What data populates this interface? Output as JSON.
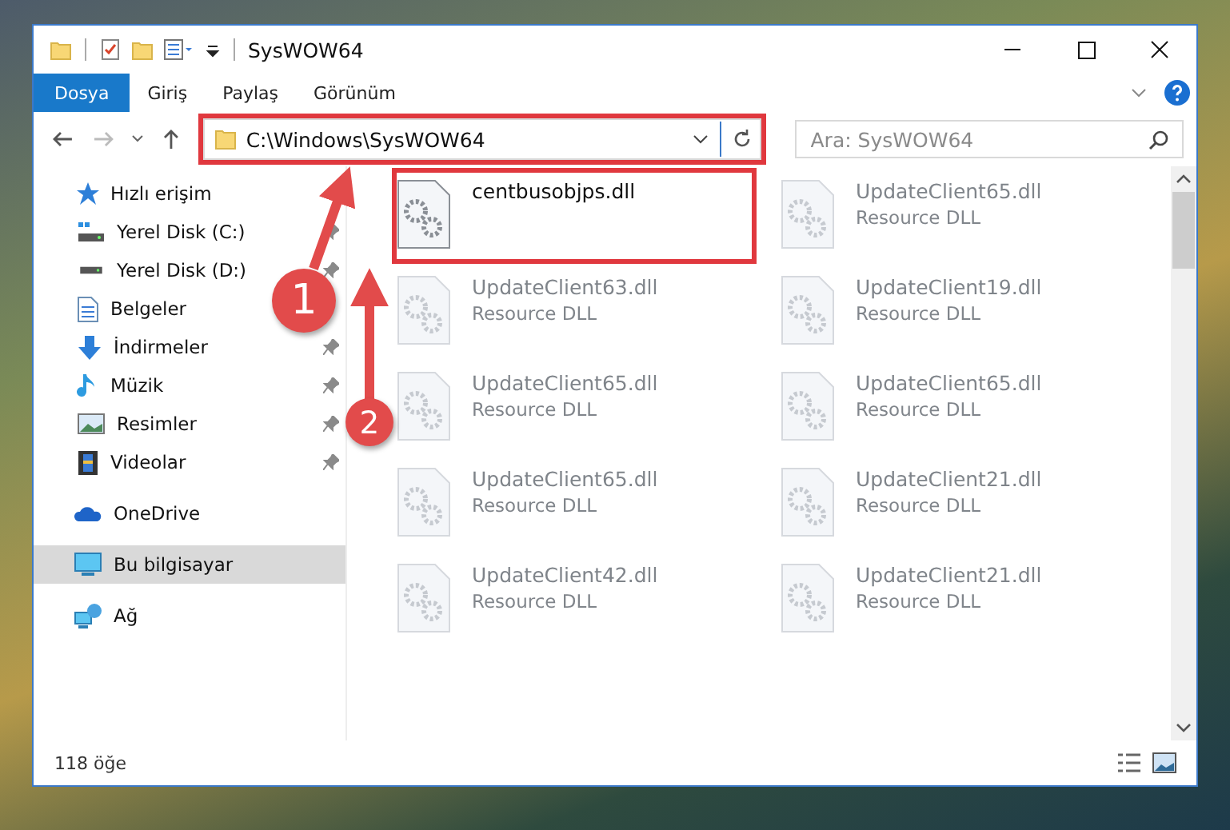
{
  "window": {
    "title": "SysWOW64"
  },
  "ribbon_tabs": [
    {
      "label": "Dosya",
      "selected": true
    },
    {
      "label": "Giriş",
      "selected": false
    },
    {
      "label": "Paylaş",
      "selected": false
    },
    {
      "label": "Görünüm",
      "selected": false
    }
  ],
  "address_bar": {
    "path": "C:\\Windows\\SysWOW64",
    "highlighted": true
  },
  "search": {
    "placeholder": "Ara: SysWOW64"
  },
  "sidebar": {
    "items": [
      {
        "label": "Hızlı erişim",
        "kind": "star",
        "selected": false,
        "children": [
          {
            "label": "Yerel Disk (C:)",
            "kind": "system-drive",
            "pinned": true,
            "selected": false
          },
          {
            "label": "Yerel Disk (D:)",
            "kind": "drive",
            "pinned": true,
            "selected": false
          },
          {
            "label": "Belgeler",
            "kind": "document",
            "pinned": false,
            "selected": false
          },
          {
            "label": "İndirmeler",
            "kind": "download",
            "pinned": true,
            "selected": false
          },
          {
            "label": "Müzik",
            "kind": "music",
            "pinned": true,
            "selected": false
          },
          {
            "label": "Resimler",
            "kind": "picture",
            "pinned": true,
            "selected": false
          },
          {
            "label": "Videolar",
            "kind": "video",
            "pinned": true,
            "selected": false
          }
        ]
      },
      {
        "label": "OneDrive",
        "kind": "cloud",
        "selected": false
      },
      {
        "label": "Bu bilgisayar",
        "kind": "computer",
        "selected": true
      },
      {
        "label": "Ağ",
        "kind": "network",
        "selected": false
      }
    ]
  },
  "files": [
    {
      "name": "centbusobjps.dll",
      "blurred": false,
      "highlighted": true
    },
    {
      "name": "UpdateClient65.dll",
      "type": "Resource DLL",
      "blurred": true,
      "highlighted": false
    },
    {
      "name": "UpdateClient63.dll",
      "type": "Resource DLL",
      "blurred": true,
      "highlighted": false
    },
    {
      "name": "UpdateClient19.dll",
      "type": "Resource DLL",
      "blurred": true,
      "highlighted": false
    },
    {
      "name": "UpdateClient65.dll",
      "type": "Resource DLL",
      "blurred": true,
      "highlighted": false
    },
    {
      "name": "UpdateClient65.dll",
      "type": "Resource DLL",
      "blurred": true,
      "highlighted": false
    },
    {
      "name": "UpdateClient65.dll",
      "type": "Resource DLL",
      "blurred": true,
      "highlighted": false
    },
    {
      "name": "UpdateClient21.dll",
      "type": "Resource DLL",
      "blurred": true,
      "highlighted": false
    },
    {
      "name": "UpdateClient42.dll",
      "type": "Resource DLL",
      "blurred": true,
      "highlighted": false
    },
    {
      "name": "UpdateClient21.dll",
      "type": "Resource DLL",
      "blurred": true,
      "highlighted": false
    }
  ],
  "annotations": [
    {
      "number": "1",
      "kind": "address"
    },
    {
      "number": "2",
      "kind": "file"
    }
  ],
  "status_bar": {
    "item_count": "118 öğe"
  }
}
